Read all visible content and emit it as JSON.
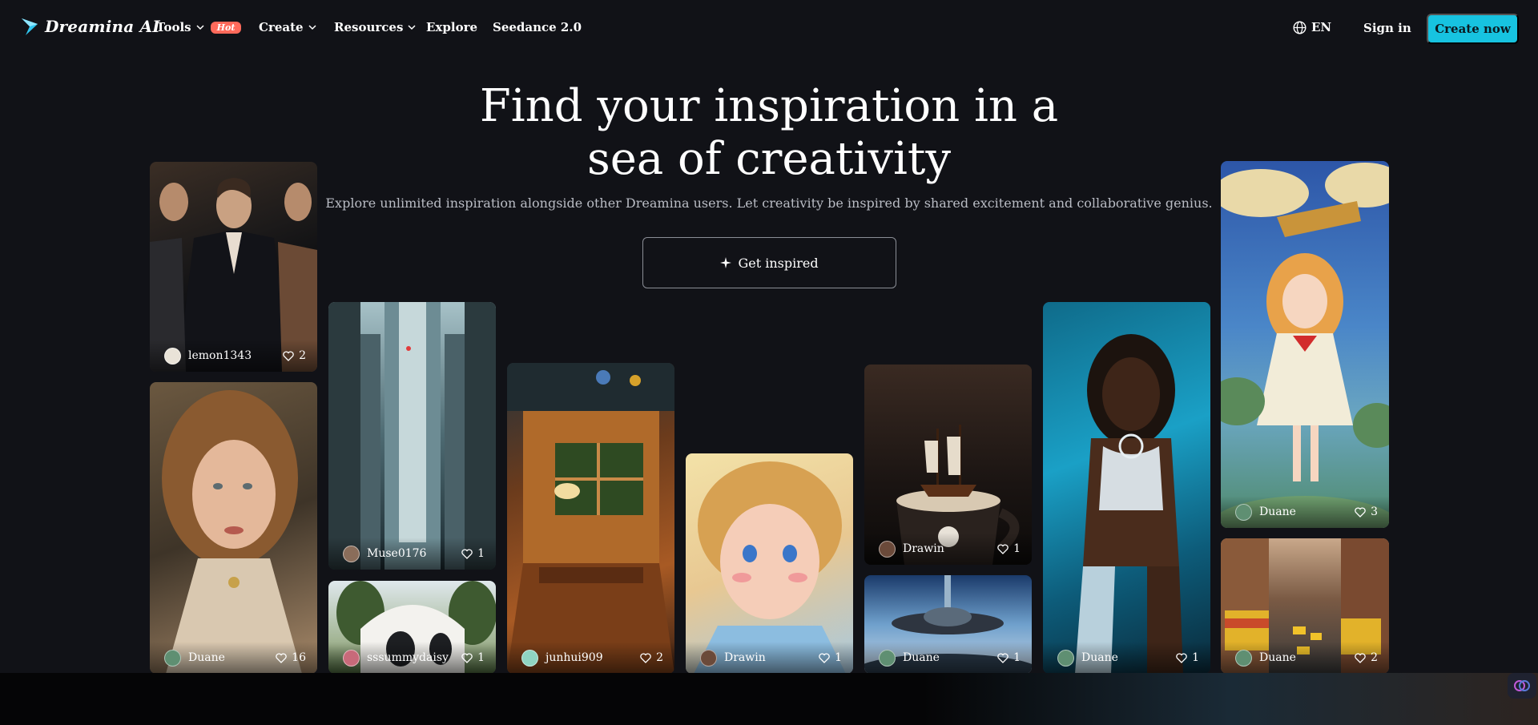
{
  "nav": {
    "logo_text": "Dreamina AI",
    "items": [
      {
        "label": "Tools",
        "dropdown": true,
        "badge": "Hot"
      },
      {
        "label": "Create",
        "dropdown": true
      },
      {
        "label": "Resources",
        "dropdown": true
      },
      {
        "label": "Explore",
        "dropdown": false
      },
      {
        "label": "Seedance 2.0",
        "dropdown": false
      }
    ],
    "language": "EN",
    "sign_in": "Sign in",
    "create_now": "Create now"
  },
  "hero": {
    "title": "Find your inspiration in a sea of creativity",
    "subtitle": "Explore unlimited inspiration alongside other Dreamina users. Let creativity be inspired by shared excitement and collaborative genius.",
    "cta": "Get inspired"
  },
  "gallery": [
    {
      "user": "lemon1343",
      "likes": "2",
      "icon": "fashion-models-image"
    },
    {
      "user": "Duane",
      "likes": "16",
      "icon": "curly-hair-woman-image"
    },
    {
      "user": "Muse0176",
      "likes": "1",
      "icon": "futuristic-tower-image"
    },
    {
      "user": "sssummydaisy",
      "likes": "1",
      "icon": "white-dome-house-image"
    },
    {
      "user": "junhui909",
      "likes": "2",
      "icon": "isometric-dining-room-image"
    },
    {
      "user": "Drawin",
      "likes": "1",
      "icon": "curly-boy-illustration-image"
    },
    {
      "user": "Drawin",
      "likes": "1",
      "icon": "pirate-ship-mug-image"
    },
    {
      "user": "Duane",
      "likes": "1",
      "icon": "ufo-landscape-image"
    },
    {
      "user": "Duane",
      "likes": "1",
      "icon": "silver-armor-woman-image"
    },
    {
      "user": "Duane",
      "likes": "3",
      "icon": "anime-girl-sky-image"
    },
    {
      "user": "Duane",
      "likes": "2",
      "icon": "city-street-trams-image"
    }
  ],
  "colors": {
    "background": "#111217",
    "accent": "#17c3e0",
    "hot_badge": "#ff6a5b"
  }
}
